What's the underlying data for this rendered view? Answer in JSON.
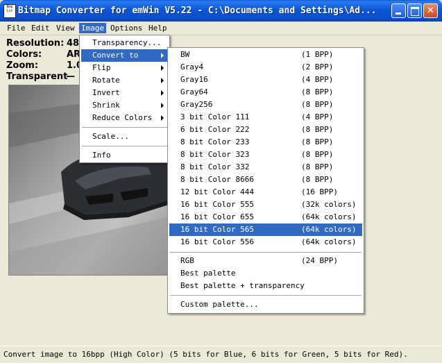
{
  "window": {
    "icon_text": "Bmp Cvt",
    "title": "Bitmap Converter for emWin V5.22 - C:\\Documents and Settings\\Ad...",
    "controls": [
      "minimize",
      "maximize",
      "close"
    ]
  },
  "menubar": {
    "items": [
      {
        "label": "File"
      },
      {
        "label": "Edit"
      },
      {
        "label": "View"
      },
      {
        "label": "Image"
      },
      {
        "label": "Options"
      },
      {
        "label": "Help"
      }
    ],
    "active": "Image"
  },
  "info": {
    "resolution_label": "Resolution:",
    "resolution_value": "48",
    "colors_label": "Colors:",
    "colors_value": "AR",
    "zoom_label": "Zoom:",
    "zoom_value": "1.0",
    "transparent_label": "Transparent",
    "transparent_value": "—"
  },
  "image_menu": {
    "items": [
      {
        "label": "Transparency...",
        "submenu": false
      },
      {
        "label": "Convert to",
        "submenu": true,
        "highlighted": true
      },
      {
        "label": "Flip",
        "submenu": true
      },
      {
        "label": "Rotate",
        "submenu": true
      },
      {
        "label": "Invert",
        "submenu": true
      },
      {
        "label": "Shrink",
        "submenu": true
      },
      {
        "label": "Reduce Colors",
        "submenu": true
      },
      {
        "label": "Scale...",
        "submenu": false
      },
      {
        "label": "Info",
        "submenu": false
      }
    ]
  },
  "convert_menu": {
    "items": [
      {
        "label": "BW",
        "format": "(1 BPP)"
      },
      {
        "label": "Gray4",
        "format": "(2 BPP)"
      },
      {
        "label": "Gray16",
        "format": "(4 BPP)"
      },
      {
        "label": "Gray64",
        "format": "(8 BPP)"
      },
      {
        "label": "Gray256",
        "format": "(8 BPP)"
      },
      {
        "label": "3 bit Color 111",
        "format": "(4 BPP)"
      },
      {
        "label": "6 bit Color 222",
        "format": "(8 BPP)"
      },
      {
        "label": "8 bit Color 233",
        "format": "(8 BPP)"
      },
      {
        "label": "8 bit Color 323",
        "format": "(8 BPP)"
      },
      {
        "label": "8 bit Color 332",
        "format": "(8 BPP)"
      },
      {
        "label": "8 bit Color 8666",
        "format": "(8 BPP)"
      },
      {
        "label": "12 bit Color 444",
        "format": "(16 BPP)"
      },
      {
        "label": "16 bit Color 555",
        "format": "(32k colors)"
      },
      {
        "label": "16 bit Color 655",
        "format": "(64k colors)"
      },
      {
        "label": "16 bit Color 565",
        "format": "(64k colors)",
        "highlighted": true
      },
      {
        "label": "16 bit Color 556",
        "format": "(64k colors)"
      },
      {
        "label": "RGB",
        "format": "(24 BPP)"
      },
      {
        "label": "Best palette",
        "format": ""
      },
      {
        "label": "Best palette + transparency",
        "format": ""
      },
      {
        "label": "Custom palette...",
        "format": ""
      }
    ]
  },
  "status": {
    "text": "Convert image to 16bpp (High Color) (5 bits for Blue, 6 bits for Green, 5 bits for Red)."
  },
  "colors": {
    "titlebar": "#0a56d6",
    "highlight": "#316ac5",
    "face": "#ece9d8"
  }
}
